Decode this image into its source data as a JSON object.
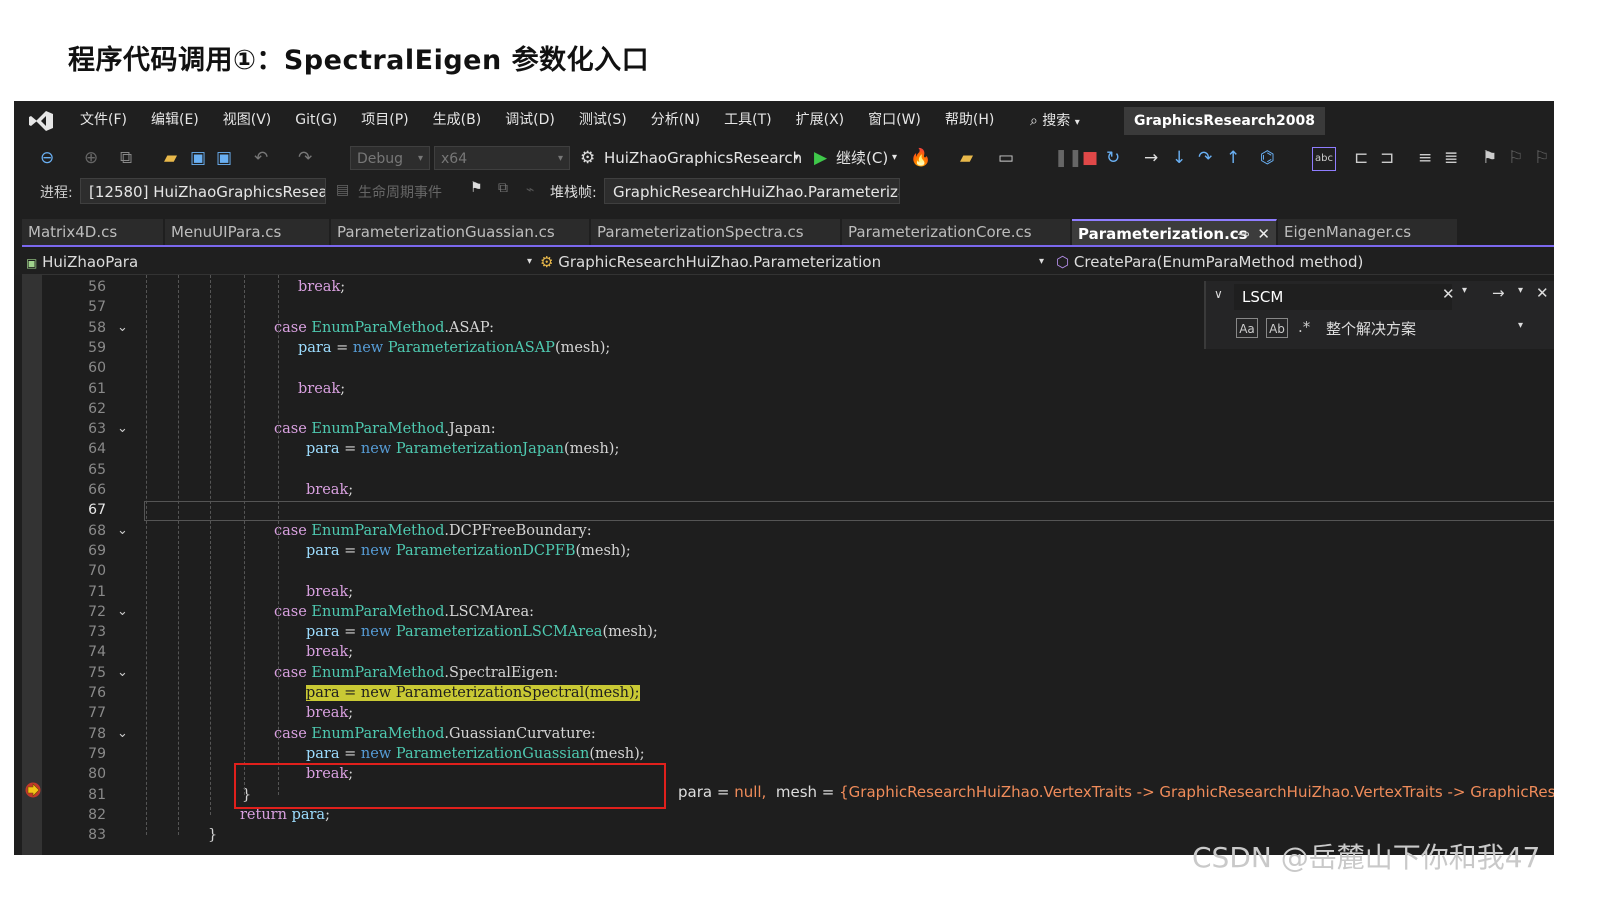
{
  "slide_title": "程序代码调用①：SpectralEigen 参数化入口",
  "menu": [
    "文件(F)",
    "编辑(E)",
    "视图(V)",
    "Git(G)",
    "项目(P)",
    "生成(B)",
    "调试(D)",
    "测试(S)",
    "分析(N)",
    "工具(T)",
    "扩展(X)",
    "窗口(W)",
    "帮助(H)"
  ],
  "search_label": "搜索",
  "solution_name": "GraphicsResearch2008",
  "toolbar": {
    "config": "Debug",
    "platform": "x64",
    "startup_project": "HuiZhaoGraphicsResearch",
    "continue_label": "继续(C)"
  },
  "process_bar": {
    "process_label": "进程:",
    "process_value": "[12580] HuiZhaoGraphicsResea",
    "lifecycle_label": "生命周期事件",
    "stackframe_label": "堆栈帧:",
    "stackframe_value": "GraphicResearchHuiZhao.Parameteriza"
  },
  "tabs": [
    "Matrix4D.cs",
    "MenuUIPara.cs",
    "ParameterizationGuassian.cs",
    "ParameterizationSpectra.cs",
    "ParameterizationCore.cs",
    "Parameterization.cs",
    "EigenManager.cs"
  ],
  "active_tab": "Parameterization.cs",
  "navbar": {
    "project": "HuiZhaoPara",
    "class": "GraphicResearchHuiZhao.Parameterization",
    "member": "CreatePara(EnumParaMethod method)"
  },
  "find": {
    "query": "LSCM",
    "scope": "整个解决方案",
    "match_case": "Aa",
    "whole_word": "Ab"
  },
  "code_lines": [
    {
      "n": "56",
      "t": "break;"
    },
    {
      "n": "57",
      "t": ""
    },
    {
      "n": "58",
      "t": "case EnumParaMethod.ASAP:"
    },
    {
      "n": "59",
      "t": "para = new ParameterizationASAP(mesh);"
    },
    {
      "n": "60",
      "t": ""
    },
    {
      "n": "61",
      "t": "break;"
    },
    {
      "n": "62",
      "t": ""
    },
    {
      "n": "63",
      "t": "case EnumParaMethod.Japan:"
    },
    {
      "n": "64",
      "t": "para = new ParameterizationJapan(mesh);"
    },
    {
      "n": "65",
      "t": ""
    },
    {
      "n": "66",
      "t": "break;"
    },
    {
      "n": "67",
      "t": ""
    },
    {
      "n": "68",
      "t": "case EnumParaMethod.DCPFreeBoundary:"
    },
    {
      "n": "69",
      "t": "para = new ParameterizationDCPFB(mesh);"
    },
    {
      "n": "70",
      "t": ""
    },
    {
      "n": "71",
      "t": "break;"
    },
    {
      "n": "72",
      "t": "case EnumParaMethod.LSCMArea:"
    },
    {
      "n": "73",
      "t": "para = new ParameterizationLSCMArea(mesh);"
    },
    {
      "n": "74",
      "t": "break;"
    },
    {
      "n": "75",
      "t": "case EnumParaMethod.SpectralEigen:"
    },
    {
      "n": "76",
      "t": "para = new ParameterizationSpectral(mesh);"
    },
    {
      "n": "77",
      "t": "break;"
    },
    {
      "n": "78",
      "t": "case EnumParaMethod.GuassianCurvature:"
    },
    {
      "n": "79",
      "t": "para = new ParameterizationGuassian(mesh);"
    },
    {
      "n": "80",
      "t": "break;"
    },
    {
      "n": "81",
      "t": "}"
    },
    {
      "n": "82",
      "t": "return para;"
    },
    {
      "n": "83",
      "t": "}"
    }
  ],
  "datatip": {
    "para_name": "para = ",
    "para_value": "null,",
    "mesh_name": "mesh = ",
    "mesh_value": "{GraphicResearchHuiZhao.VertexTraits -> GraphicResearchHuiZhao.VertexTraits -> GraphicResearchHuiZhao"
  },
  "watermark": "CSDN @岳麓山下你和我47"
}
